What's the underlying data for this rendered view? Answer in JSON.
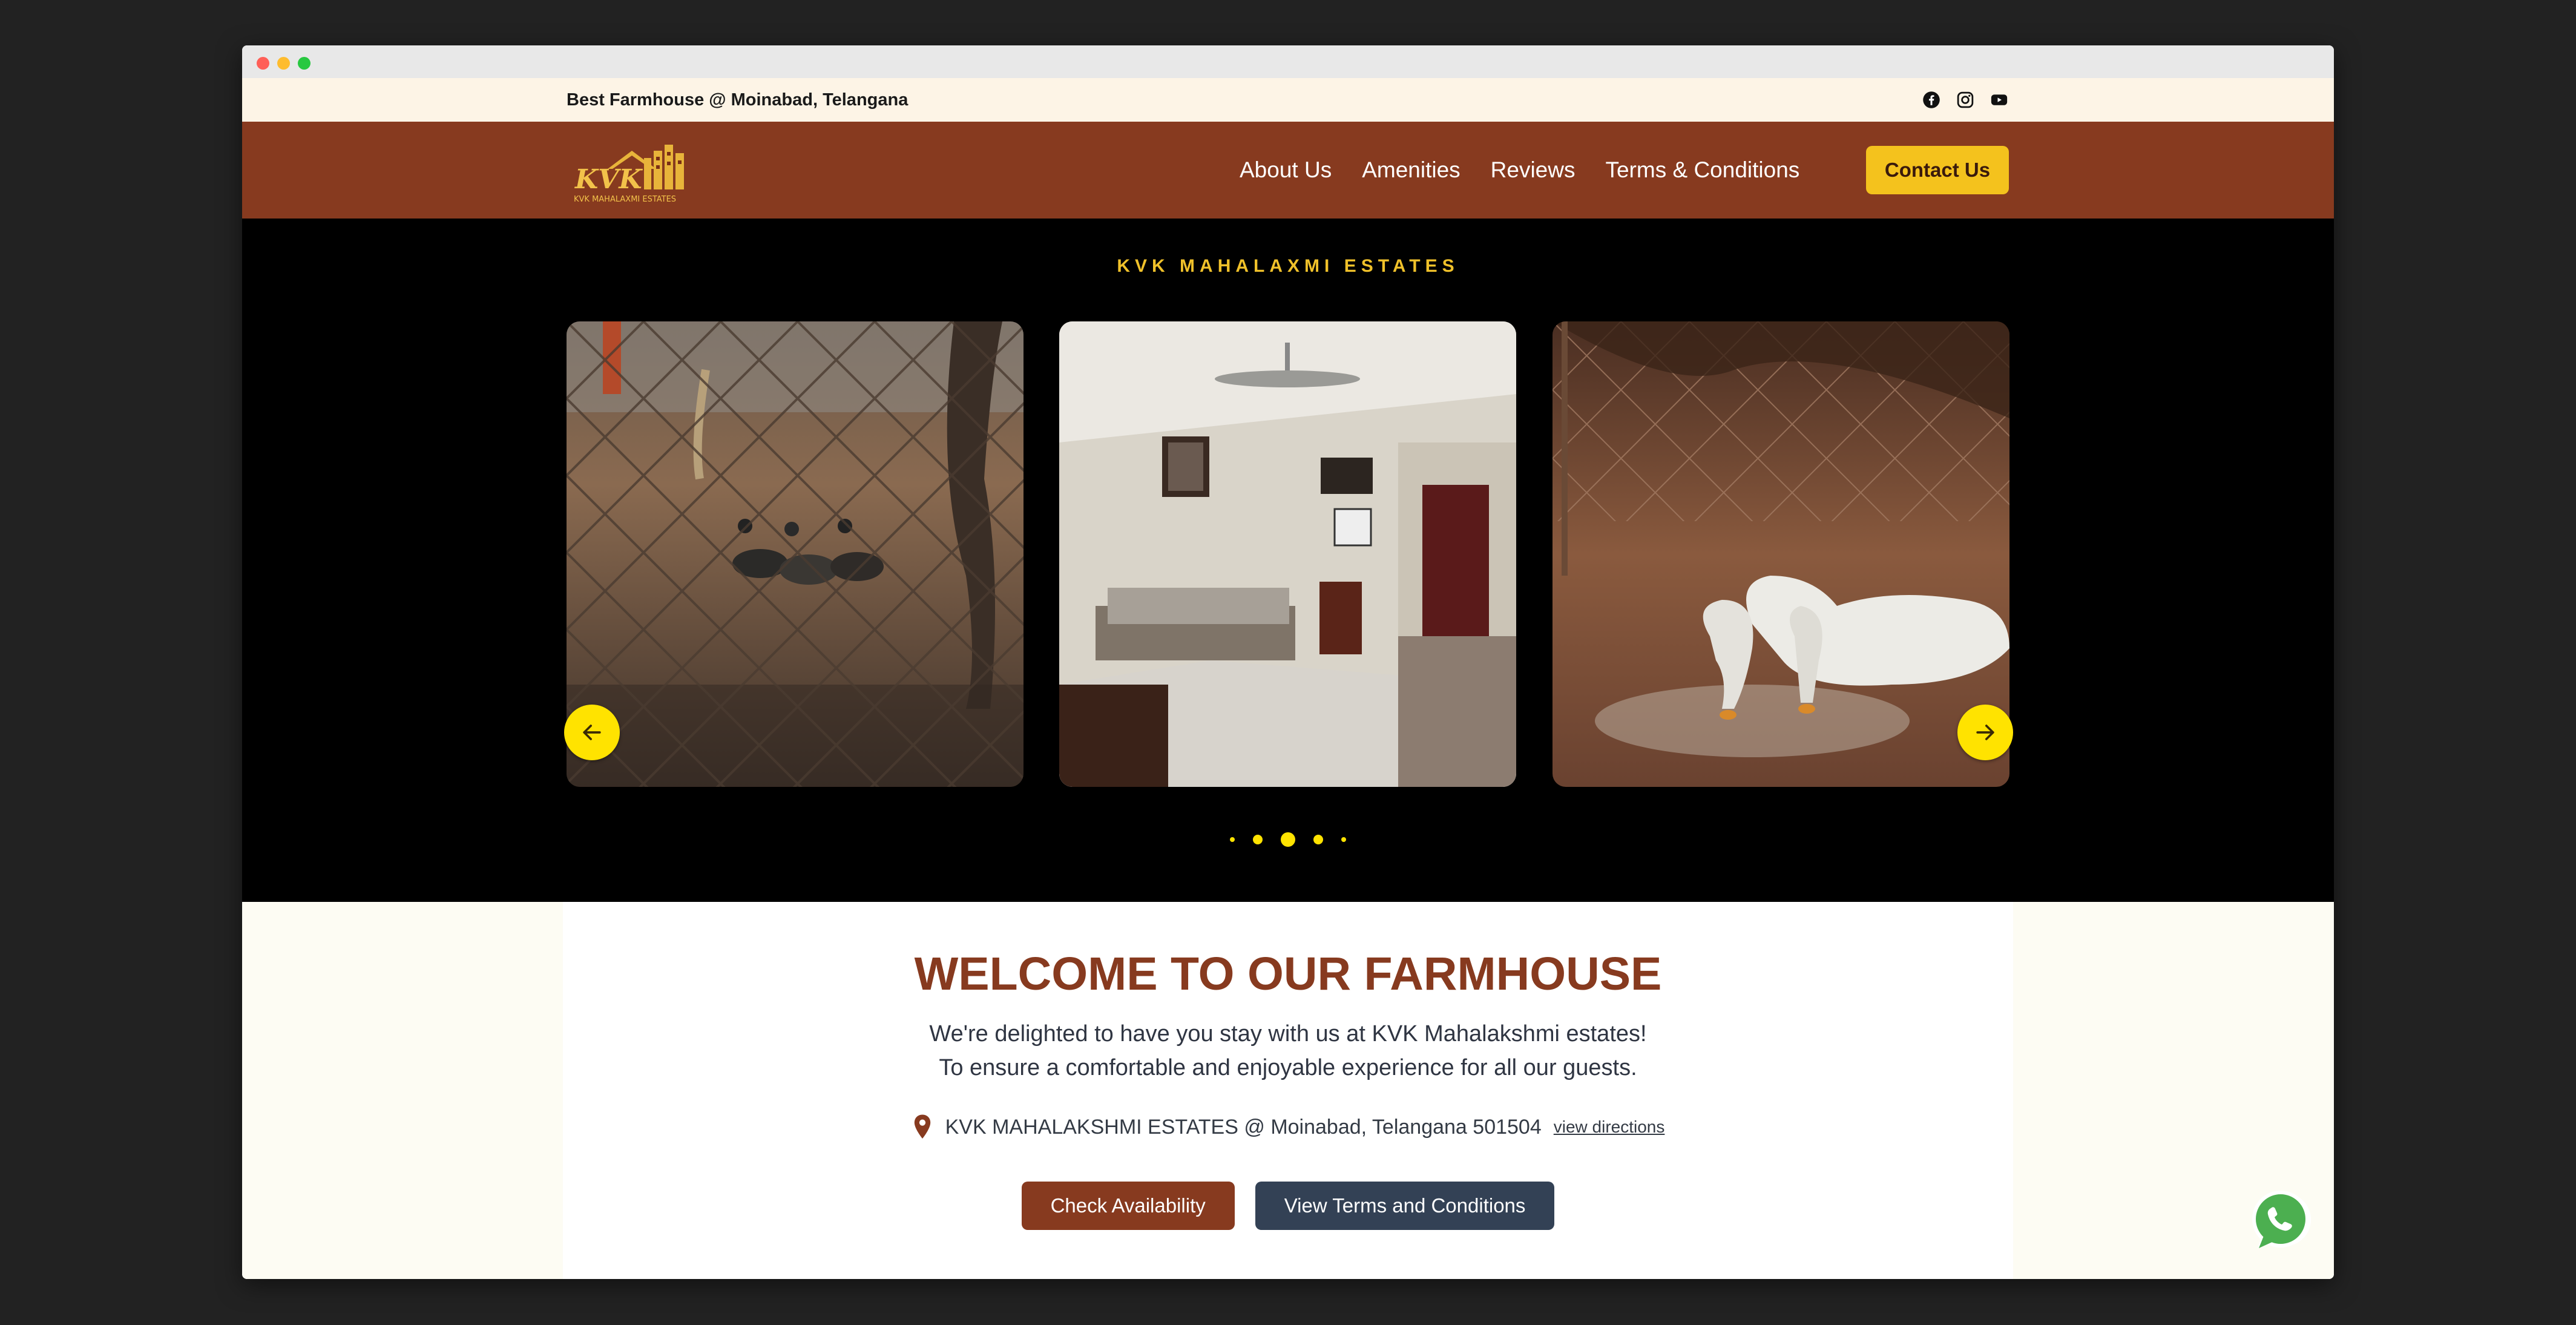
{
  "topbar": {
    "tagline": "Best Farmhouse @ Moinabad, Telangana",
    "social": [
      "facebook-icon",
      "instagram-icon",
      "youtube-icon"
    ]
  },
  "navbar": {
    "logo_text": "KVK",
    "logo_subtext": "KVK MAHALAXMI ESTATES",
    "links": [
      "About Us",
      "Amenities",
      "Reviews",
      "Terms & Conditions"
    ],
    "contact_label": "Contact Us"
  },
  "hero": {
    "title": "KVK MAHALAXMI ESTATES",
    "slides": [
      {
        "subject": "ducks behind fence"
      },
      {
        "subject": "living room interior"
      },
      {
        "subject": "white geese feeding"
      }
    ],
    "dots_count": 5,
    "active_dot": 2
  },
  "welcome": {
    "title": "WELCOME TO OUR FARMHOUSE",
    "description": "We're delighted to have you stay with us at KVK Mahalakshmi estates! To ensure a comfortable and enjoyable experience for all our guests.",
    "address": "KVK MAHALAKSHMI ESTATES @ Moinabad, Telangana 501504",
    "directions_label": "view directions",
    "check_availability_label": "Check Availability",
    "view_terms_label": "View Terms and Conditions"
  },
  "colors": {
    "brand_brown": "#873a1f",
    "accent_yellow": "#f4c21d",
    "cream": "#fdf4e6",
    "dark_button": "#334155"
  }
}
